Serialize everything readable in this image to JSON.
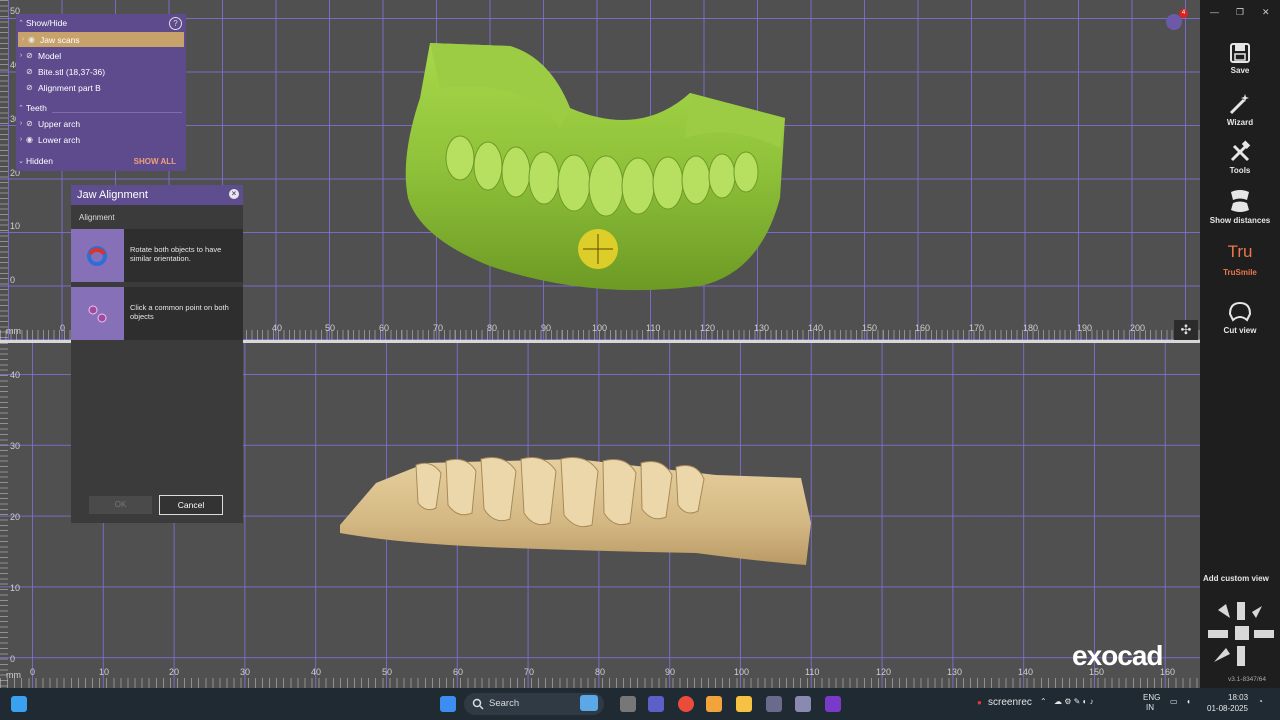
{
  "top_view": {
    "x_ticks": [
      "0",
      "40",
      "50",
      "60",
      "70",
      "80",
      "90",
      "100",
      "110",
      "120",
      "130",
      "140",
      "150",
      "160",
      "170",
      "180",
      "190",
      "200"
    ],
    "y_ticks": [
      "50",
      "40",
      "30",
      "20",
      "10",
      "0"
    ],
    "unit": "mm"
  },
  "bottom_view": {
    "x_ticks": [
      "0",
      "10",
      "20",
      "30",
      "40",
      "50",
      "60",
      "70",
      "80",
      "90",
      "100",
      "110",
      "120",
      "130",
      "140",
      "150",
      "160"
    ],
    "y_ticks": [
      "40",
      "30",
      "20",
      "10",
      "0"
    ],
    "unit": "mm"
  },
  "show_hide": {
    "title": "Show/Hide",
    "items": [
      {
        "label": "Jaw scans",
        "selected": true
      },
      {
        "label": "Model"
      },
      {
        "label": "Bite.stl (18,37-36)"
      },
      {
        "label": "Alignment part B"
      }
    ],
    "teeth_header": "Teeth",
    "teeth_items": [
      {
        "label": "Upper arch"
      },
      {
        "label": "Lower arch"
      }
    ],
    "hidden_label": "Hidden",
    "show_all": "SHOW ALL"
  },
  "dialog": {
    "title": "Jaw Alignment",
    "section": "Alignment",
    "steps": [
      {
        "text": "Rotate both objects to have similar orientation."
      },
      {
        "text": "Click a common point on both objects"
      }
    ],
    "ok_label": "OK",
    "cancel_label": "Cancel"
  },
  "sidebar": {
    "items": [
      {
        "label": "Save",
        "icon": "save-icon"
      },
      {
        "label": "Wizard",
        "icon": "wizard-icon"
      },
      {
        "label": "Tools",
        "icon": "tools-icon"
      },
      {
        "label": "Show distances",
        "icon": "show-distances-icon"
      },
      {
        "label": "TruSmile",
        "icon": "trusmile-icon",
        "icon_text": "Tru"
      },
      {
        "label": "Cut view",
        "icon": "cut-view-icon"
      }
    ],
    "add_custom_view": "Add custom view",
    "version": "v3.1-8347/64",
    "notification_count": "4"
  },
  "brand": "exocad",
  "taskbar": {
    "search_placeholder": "Search",
    "screenrec": "screenrec",
    "lang": "ENG",
    "region": "IN",
    "time": "18:03",
    "date": "01-08-2025"
  },
  "colors": {
    "accent": "#5e4d8f",
    "selection": "#c7a26a",
    "upper_model": "#8fc23a",
    "lower_model": "#d8bd8a"
  }
}
